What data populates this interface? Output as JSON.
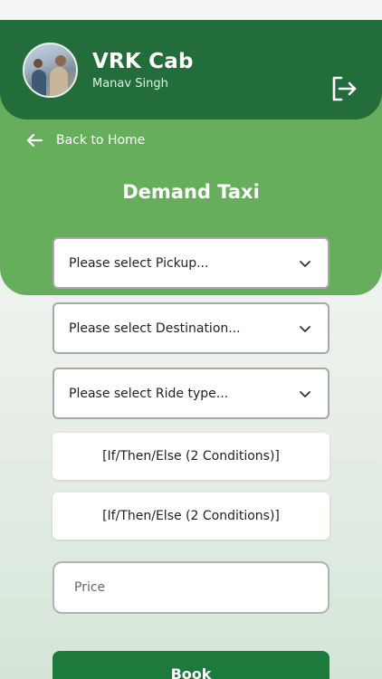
{
  "header": {
    "app_name": "VRK Cab",
    "user_name": "Manav Singh",
    "avatar_icon": "user-photo",
    "logout_icon": "logout-icon"
  },
  "nav": {
    "back_label": "Back to Home",
    "back_icon": "arrow-left-icon"
  },
  "page": {
    "title": "Demand Taxi"
  },
  "form": {
    "pickup_placeholder": "Please select Pickup...",
    "destination_placeholder": "Please select Destination...",
    "ride_type_placeholder": "Please select Ride type...",
    "condition_1": "[If/Then/Else (2 Conditions)]",
    "condition_2": "[If/Then/Else (2 Conditions)]",
    "price_placeholder": "Price",
    "book_label": "Book"
  },
  "colors": {
    "header_dark_green": "#236d3b",
    "header_light_green": "#67ae5c",
    "button_green": "#1c7a3c"
  }
}
